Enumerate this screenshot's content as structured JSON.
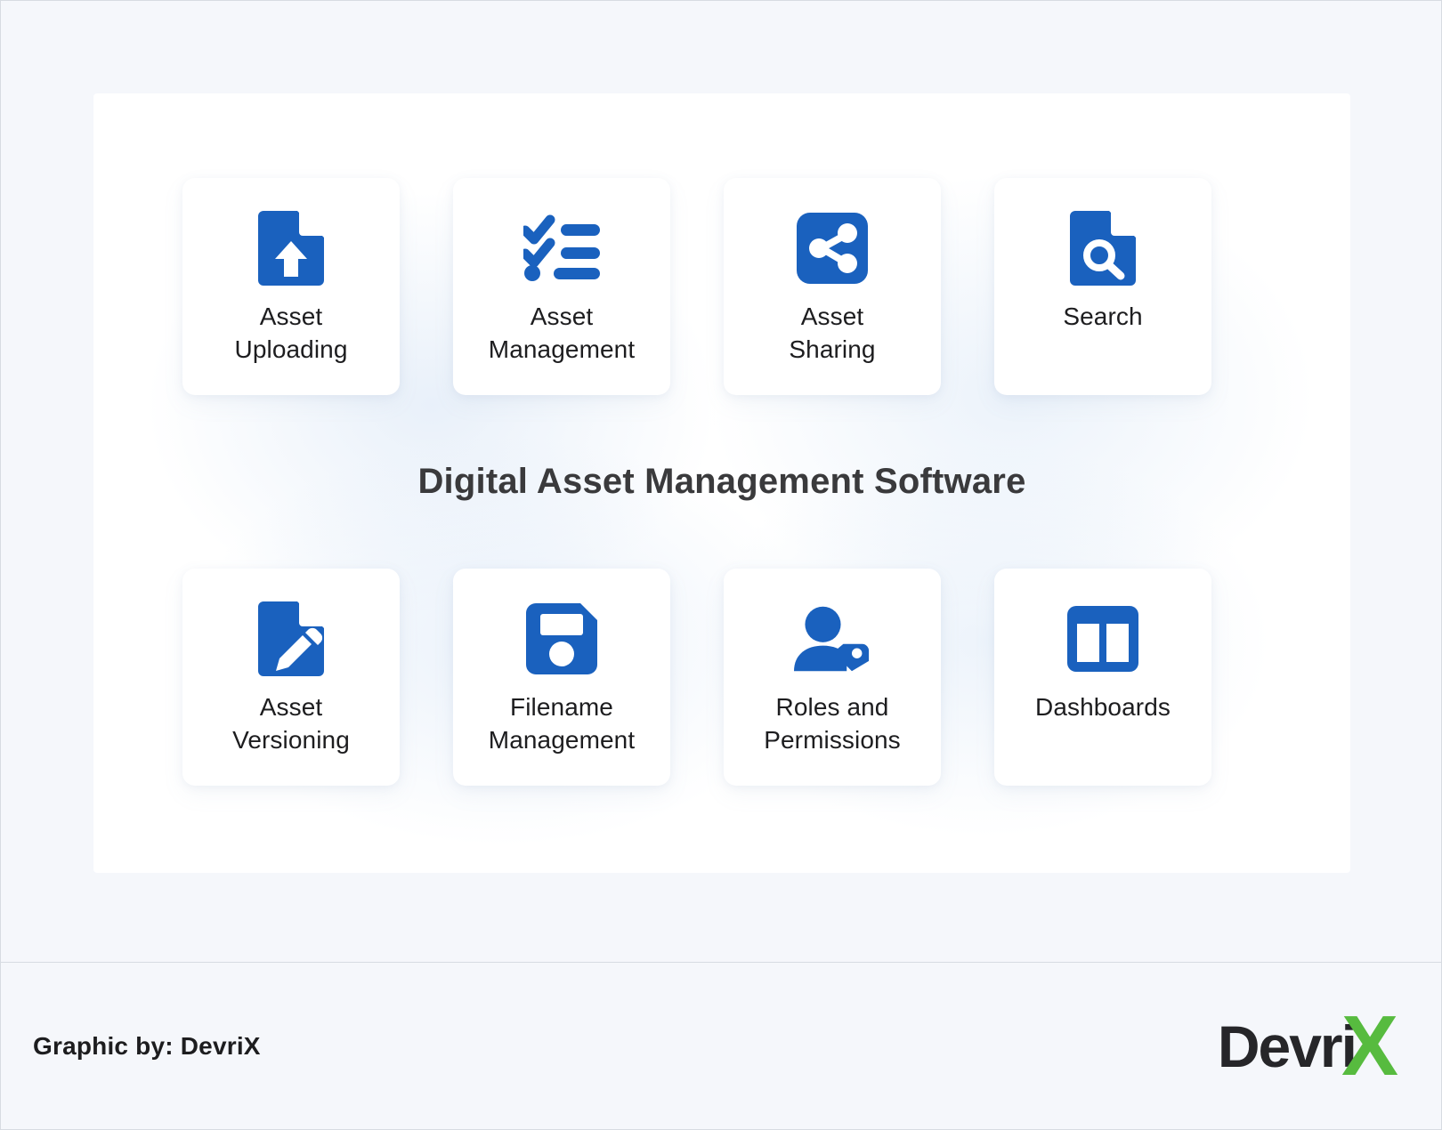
{
  "theme": {
    "page_background": "#f5f7fb",
    "panel_background": "#ffffff",
    "icon_blue": "#1a61be",
    "title_color": "#3a3a3c",
    "label_color": "#1d1d1f",
    "logo_green": "#57bb3f",
    "logo_dark": "#262629"
  },
  "title": "Digital Asset Management Software",
  "cards": {
    "top_row": [
      {
        "label": "Asset\nUploading",
        "icon": "document-upload-icon"
      },
      {
        "label": "Asset\nManagement",
        "icon": "checklist-icon"
      },
      {
        "label": "Asset\nSharing",
        "icon": "share-square-icon"
      },
      {
        "label": "Search",
        "icon": "document-search-icon"
      }
    ],
    "bottom_row": [
      {
        "label": "Asset\nVersioning",
        "icon": "document-edit-icon"
      },
      {
        "label": "Filename\nManagement",
        "icon": "floppy-save-icon"
      },
      {
        "label": "Roles and\nPermissions",
        "icon": "user-tag-icon"
      },
      {
        "label": "Dashboards",
        "icon": "dashboard-columns-icon"
      }
    ]
  },
  "footer": {
    "credit": "Graphic by: DevriX",
    "logo_text": "Devri",
    "logo_mark": "X"
  }
}
